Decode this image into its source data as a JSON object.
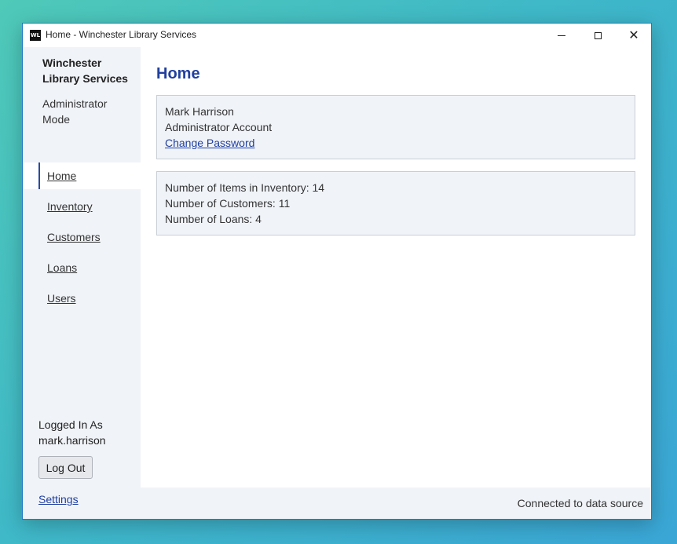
{
  "window": {
    "title": "Home - Winchester Library Services",
    "icon_text": "WL"
  },
  "sidebar": {
    "app_name": "Winchester Library Services",
    "mode": "Administrator Mode",
    "items": [
      {
        "label": "Home",
        "active": true
      },
      {
        "label": "Inventory",
        "active": false
      },
      {
        "label": "Customers",
        "active": false
      },
      {
        "label": "Loans",
        "active": false
      },
      {
        "label": "Users",
        "active": false
      }
    ],
    "logged_in_label": "Logged In As",
    "logged_in_user": "mark.harrison",
    "logout_label": "Log Out"
  },
  "main": {
    "title": "Home",
    "account": {
      "name": "Mark Harrison",
      "type": "Administrator Account",
      "change_password": "Change Password"
    },
    "stats": {
      "items": "Number of Items in Inventory: 14",
      "customers": "Number of Customers: 11",
      "loans": "Number of Loans: 4"
    }
  },
  "statusbar": {
    "settings_label": "Settings",
    "status": "Connected to data source"
  },
  "colors": {
    "accent": "#2040a0",
    "sidebar_bg": "#f0f3f8",
    "card_border": "#c9ced6"
  }
}
